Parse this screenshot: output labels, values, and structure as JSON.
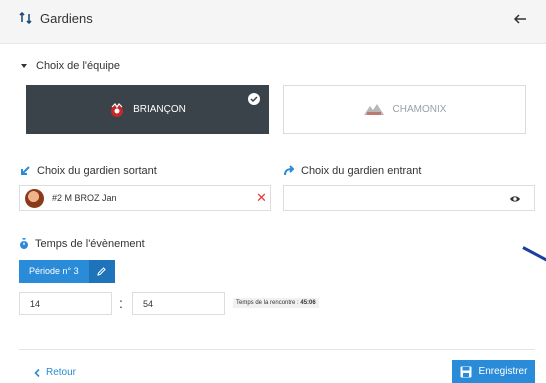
{
  "header": {
    "title": "Gardiens"
  },
  "team_section": {
    "label": "Choix de l'équipe",
    "teams": [
      {
        "name": "BRIANÇON",
        "selected": true
      },
      {
        "name": "CHAMONIX",
        "selected": false
      }
    ]
  },
  "goalie_out": {
    "label": "Choix du gardien sortant",
    "value": "#2 M BROZ Jan"
  },
  "goalie_in": {
    "label": "Choix du gardien entrant",
    "value": ""
  },
  "event_time": {
    "label": "Temps de l'évènement",
    "period_label": "Période n° 3",
    "minutes": "14",
    "separator": ":",
    "seconds": "54",
    "match_time_label": "Temps de la rencontre :",
    "match_time_value": "45:06"
  },
  "footer": {
    "back_label": "Retour",
    "save_label": "Enregistrer"
  },
  "colors": {
    "primary": "#2a8bd8",
    "active_team_bg": "#3a434a",
    "danger": "#e53935"
  },
  "icons": {
    "header_left": "swap-icon",
    "header_right": "back-arrow-icon",
    "goalie_out": "arrow-down-left-icon",
    "goalie_in": "arrow-forward-icon",
    "time": "stopwatch-icon",
    "remove": "close-icon",
    "reveal": "eye-icon",
    "edit": "pencil-icon",
    "save": "floppy-disk-icon"
  }
}
